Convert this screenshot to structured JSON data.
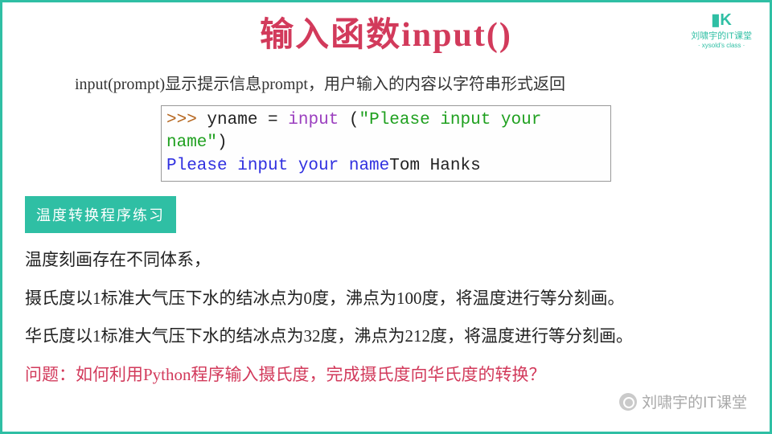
{
  "title": "输入函数input()",
  "logo": {
    "mark": "▮K",
    "name": "刘啸宇的IT课堂",
    "sub": "· xysold's class ·"
  },
  "desc": "input(prompt)显示提示信息prompt，用户输入的内容以字符串形式返回",
  "code": {
    "prompt_sym": ">>> ",
    "var": "yname ",
    "eq": "= ",
    "fn": "input ",
    "lp": "(",
    "str": "\"Please input your name\"",
    "rp": ")",
    "line2_a": "Please input your name",
    "line2_b": "Tom Hanks"
  },
  "badge": "温度转换程序练习",
  "body": {
    "p1": "温度刻画存在不同体系，",
    "p2": "摄氏度以1标准大气压下水的结冰点为0度，沸点为100度，将温度进行等分刻画。",
    "p3": "华氏度以1标准大气压下水的结冰点为32度，沸点为212度，将温度进行等分刻画。",
    "q": "问题：如何利用Python程序输入摄氏度，完成摄氏度向华氏度的转换？"
  },
  "watermark": "刘啸宇的IT课堂"
}
